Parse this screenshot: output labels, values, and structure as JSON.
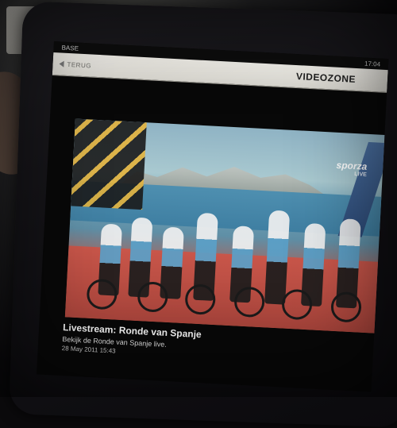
{
  "status_bar": {
    "carrier": "BASE",
    "time": "17:04"
  },
  "nav": {
    "back_label": "TERUG",
    "title": "VIDEOZONE"
  },
  "video": {
    "channel_logo_text": "sporza",
    "channel_logo_sub": "LIVE"
  },
  "caption": {
    "title": "Livestream: Ronde van Spanje",
    "description": "Bekijk de Ronde van Spanje live.",
    "date": "28 May 2011 15:43"
  }
}
